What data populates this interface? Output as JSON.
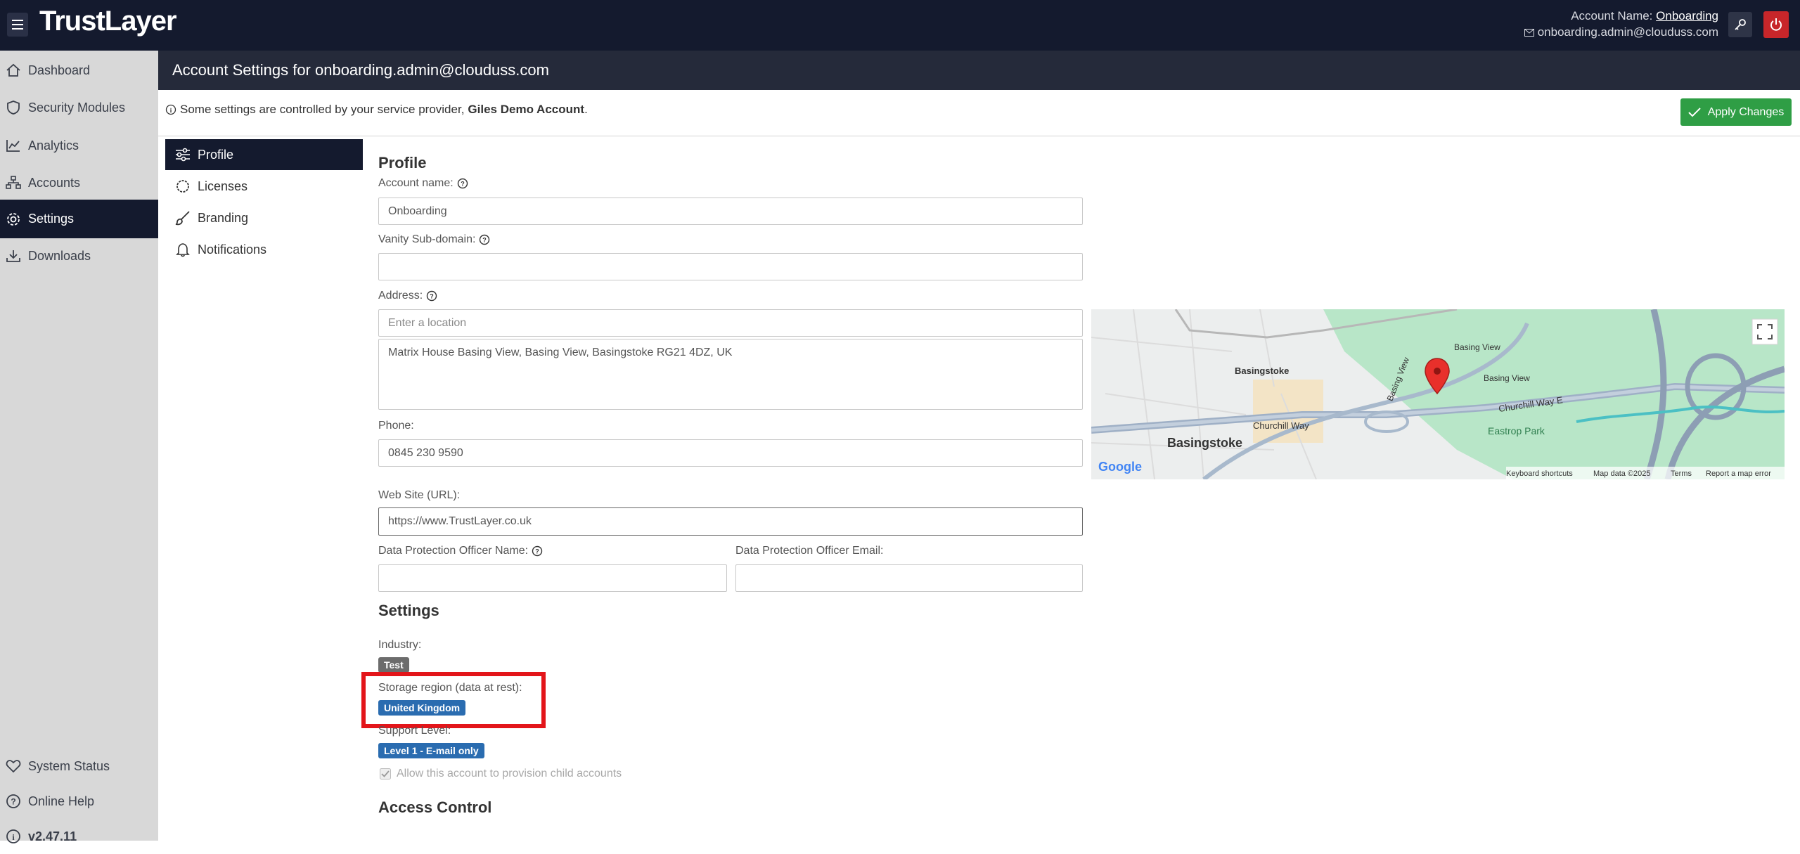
{
  "header": {
    "logo": "TrustLayer",
    "account_label": "Account Name:",
    "account_name": "Onboarding",
    "email": "onboarding.admin@clouduss.com"
  },
  "sidebar": {
    "items": [
      {
        "label": "Dashboard",
        "icon": "home-icon"
      },
      {
        "label": "Security Modules",
        "icon": "shield-icon"
      },
      {
        "label": "Analytics",
        "icon": "chart-icon"
      },
      {
        "label": "Accounts",
        "icon": "sitemap-icon"
      },
      {
        "label": "Settings",
        "icon": "gear-icon",
        "active": true
      },
      {
        "label": "Downloads",
        "icon": "download-icon"
      }
    ],
    "bottom": [
      {
        "label": "System Status",
        "icon": "heart-icon"
      },
      {
        "label": "Online Help",
        "icon": "help-icon"
      },
      {
        "label": "v2.47.11",
        "icon": "info-icon"
      }
    ]
  },
  "page": {
    "title": "Account Settings for onboarding.admin@clouduss.com",
    "notice_prefix": "Some settings are controlled by your service provider,",
    "notice_provider": "Giles Demo Account",
    "notice_suffix": ".",
    "apply_label": "Apply Changes"
  },
  "subnav": {
    "items": [
      {
        "label": "Profile",
        "icon": "sliders-icon",
        "active": true
      },
      {
        "label": "Licenses",
        "icon": "certificate-icon"
      },
      {
        "label": "Branding",
        "icon": "brush-icon"
      },
      {
        "label": "Notifications",
        "icon": "bell-icon"
      }
    ]
  },
  "profile": {
    "heading": "Profile",
    "account_name_label": "Account name:",
    "account_name_value": "Onboarding",
    "vanity_label": "Vanity Sub-domain:",
    "vanity_value": "",
    "address_label": "Address:",
    "address_placeholder": "Enter a location",
    "address_value": "Matrix House Basing View, Basing View, Basingstoke RG21 4DZ, UK",
    "phone_label": "Phone:",
    "phone_value": "0845 230 9590",
    "website_label": "Web Site (URL):",
    "website_value": "https://www.TrustLayer.co.uk",
    "dpo_name_label": "Data Protection Officer Name:",
    "dpo_name_value": "",
    "dpo_email_label": "Data Protection Officer Email:",
    "dpo_email_value": ""
  },
  "map": {
    "labels": [
      "Basingstoke",
      "Basingstoke",
      "Basing View",
      "Basing View",
      "Basing View",
      "Churchill Way",
      "Churchill Way E",
      "Eastrop Park"
    ],
    "footer": [
      "Keyboard shortcuts",
      "Map data ©2025",
      "Terms",
      "Report a map error"
    ],
    "brand": "Google"
  },
  "settings": {
    "heading": "Settings",
    "industry_label": "Industry:",
    "industry_value": "Test",
    "storage_label": "Storage region (data at rest):",
    "storage_value": "United Kingdom",
    "support_label": "Support Level:",
    "support_value": "Level 1 - E-mail only",
    "child_accounts_label": "Allow this account to provision child accounts"
  },
  "access": {
    "heading": "Access Control"
  },
  "colors": {
    "topbar": "#141a2e",
    "accent_green": "#2f9e45",
    "badge_blue": "#2a6cb0",
    "highlight_red": "#e3151a"
  }
}
